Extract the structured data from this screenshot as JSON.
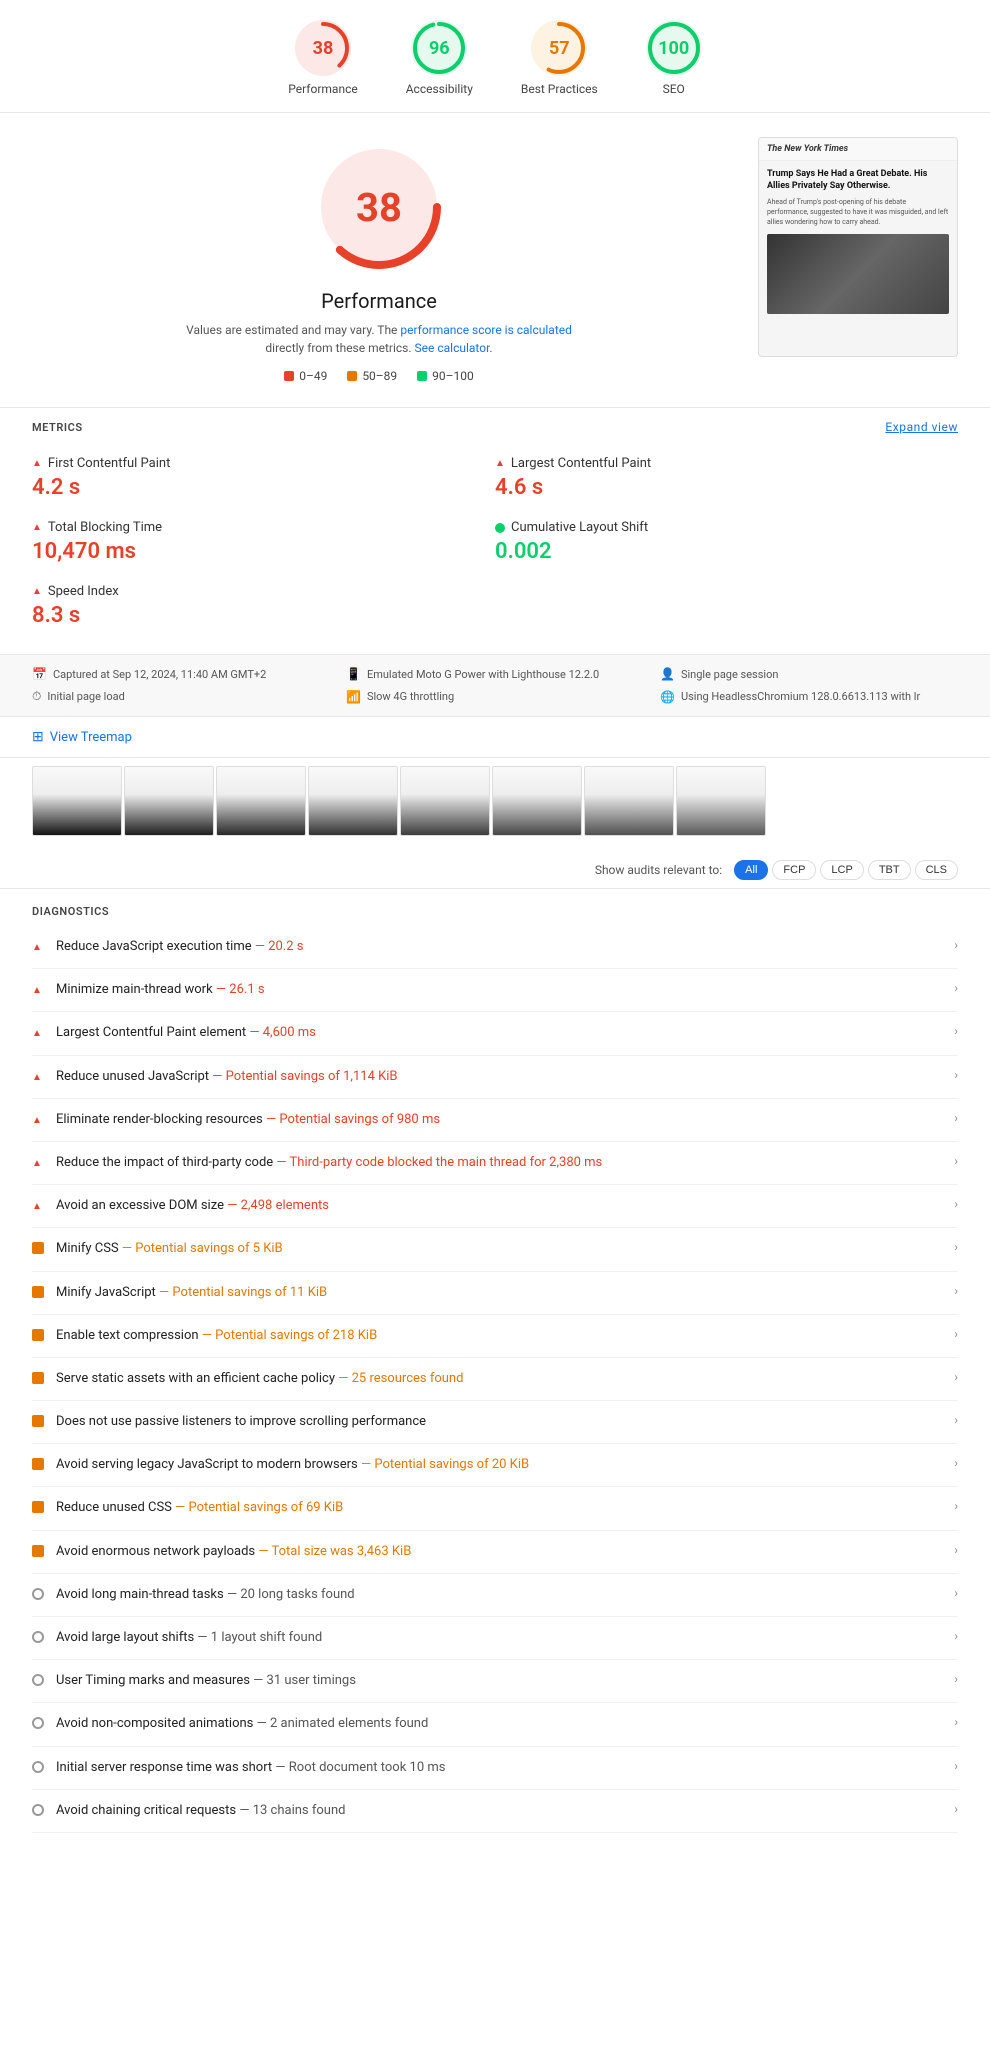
{
  "scores": [
    {
      "id": "performance",
      "label": "Performance",
      "value": 38,
      "color": "#e8412a",
      "bg": "#fce8e6",
      "dashoffset": 107
    },
    {
      "id": "accessibility",
      "label": "Accessibility",
      "value": 96,
      "color": "#0cce6b",
      "bg": "#e6f9ef",
      "dashoffset": 7
    },
    {
      "id": "best-practices",
      "label": "Best Practices",
      "value": 57,
      "color": "#e67700",
      "bg": "#fef3e2",
      "dashoffset": 75
    },
    {
      "id": "seo",
      "label": "SEO",
      "value": 100,
      "color": "#0cce6b",
      "bg": "#e6f9ef",
      "dashoffset": 0
    }
  ],
  "perf": {
    "score": 38,
    "title": "Performance",
    "desc1": "Values are estimated and may vary. The",
    "link1_text": "performance score is calculated",
    "desc2": "directly from these metrics.",
    "link2_text": "See calculator.",
    "legend": [
      {
        "label": "0–49",
        "color": "#e8412a"
      },
      {
        "label": "50–89",
        "color": "#e67700"
      },
      {
        "label": "90–100",
        "color": "#0cce6b"
      }
    ]
  },
  "screenshot": {
    "logo": "The New York Times",
    "headline": "Trump Says He Had a Great Debate. His Allies Privately Say Otherwise.",
    "text": "Ahead of Trump's post-opening of his debate performance, suggested to have it was misguided, and left allies wondering how to carry ahead."
  },
  "metrics_header": "METRICS",
  "expand_label": "Expand view",
  "metrics": [
    {
      "id": "fcp",
      "name": "First Contentful Paint",
      "value": "4.2 s",
      "color": "red",
      "icon": "tri"
    },
    {
      "id": "lcp",
      "name": "Largest Contentful Paint",
      "value": "4.6 s",
      "color": "red",
      "icon": "tri"
    },
    {
      "id": "tbt",
      "name": "Total Blocking Time",
      "value": "10,470 ms",
      "color": "red",
      "icon": "tri"
    },
    {
      "id": "cls",
      "name": "Cumulative Layout Shift",
      "value": "0.002",
      "color": "green",
      "icon": "dot"
    },
    {
      "id": "si",
      "name": "Speed Index",
      "value": "8.3 s",
      "color": "red",
      "icon": "tri"
    }
  ],
  "env": [
    {
      "icon": "📅",
      "text": "Captured at Sep 12, 2024, 11:40 AM GMT+2"
    },
    {
      "icon": "📱",
      "text": "Emulated Moto G Power with Lighthouse 12.2.0"
    },
    {
      "icon": "👤",
      "text": "Single page session"
    },
    {
      "icon": "⏱",
      "text": "Initial page load"
    },
    {
      "icon": "📶",
      "text": "Slow 4G throttling"
    },
    {
      "icon": "🌐",
      "text": "Using HeadlessChromium 128.0.6613.113 with lr"
    }
  ],
  "treemap_label": "View Treemap",
  "filter": {
    "label": "Show audits relevant to:",
    "buttons": [
      {
        "id": "all",
        "label": "All",
        "active": true
      },
      {
        "id": "fcp",
        "label": "FCP",
        "active": false
      },
      {
        "id": "lcp",
        "label": "LCP",
        "active": false
      },
      {
        "id": "tbt",
        "label": "TBT",
        "active": false
      },
      {
        "id": "cls",
        "label": "CLS",
        "active": false
      }
    ]
  },
  "diagnostics_header": "DIAGNOSTICS",
  "audits": [
    {
      "id": "js-exec",
      "icon": "tri",
      "title": "Reduce JavaScript execution time",
      "detail": " — 20.2 s",
      "detail_class": "red"
    },
    {
      "id": "main-thread",
      "icon": "tri",
      "title": "Minimize main-thread work",
      "detail": " — 26.1 s",
      "detail_class": "red"
    },
    {
      "id": "lcp-element",
      "icon": "tri",
      "title": "Largest Contentful Paint element",
      "detail": " — 4,600 ms",
      "detail_class": "red"
    },
    {
      "id": "unused-js",
      "icon": "tri",
      "title": "Reduce unused JavaScript",
      "detail": " — Potential savings of 1,114 KiB",
      "detail_class": "red"
    },
    {
      "id": "render-blocking",
      "icon": "tri",
      "title": "Eliminate render-blocking resources",
      "detail": " — Potential savings of 980 ms",
      "detail_class": "red"
    },
    {
      "id": "third-party",
      "icon": "tri",
      "title": "Reduce the impact of third-party code",
      "detail": " — Third-party code blocked the main thread for 2,380 ms",
      "detail_class": "red"
    },
    {
      "id": "dom-size",
      "icon": "tri",
      "title": "Avoid an excessive DOM size",
      "detail": " — 2,498 elements",
      "detail_class": "red"
    },
    {
      "id": "minify-css",
      "icon": "sq",
      "title": "Minify CSS",
      "detail": " — Potential savings of 5 KiB",
      "detail_class": "orange"
    },
    {
      "id": "minify-js",
      "icon": "sq",
      "title": "Minify JavaScript",
      "detail": " — Potential savings of 11 KiB",
      "detail_class": "orange"
    },
    {
      "id": "text-compression",
      "icon": "sq",
      "title": "Enable text compression",
      "detail": " — Potential savings of 218 KiB",
      "detail_class": "orange"
    },
    {
      "id": "cache-policy",
      "icon": "sq",
      "title": "Serve static assets with an efficient cache policy",
      "detail": " — 25 resources found",
      "detail_class": "orange"
    },
    {
      "id": "passive-listeners",
      "icon": "sq",
      "title": "Does not use passive listeners to improve scrolling performance",
      "detail": "",
      "detail_class": ""
    },
    {
      "id": "legacy-js",
      "icon": "sq",
      "title": "Avoid serving legacy JavaScript to modern browsers",
      "detail": " — Potential savings of 20 KiB",
      "detail_class": "orange"
    },
    {
      "id": "unused-css",
      "icon": "sq",
      "title": "Reduce unused CSS",
      "detail": " — Potential savings of 69 KiB",
      "detail_class": "orange"
    },
    {
      "id": "network-payloads",
      "icon": "sq",
      "title": "Avoid enormous network payloads",
      "detail": " — Total size was 3,463 KiB",
      "detail_class": "orange"
    },
    {
      "id": "long-tasks",
      "icon": "circle",
      "title": "Avoid long main-thread tasks",
      "detail": " — 20 long tasks found",
      "detail_class": ""
    },
    {
      "id": "layout-shifts",
      "icon": "circle",
      "title": "Avoid large layout shifts",
      "detail": " — 1 layout shift found",
      "detail_class": ""
    },
    {
      "id": "user-timing",
      "icon": "circle",
      "title": "User Timing marks and measures",
      "detail": " — 31 user timings",
      "detail_class": ""
    },
    {
      "id": "non-composited",
      "icon": "circle",
      "title": "Avoid non-composited animations",
      "detail": " — 2 animated elements found",
      "detail_class": ""
    },
    {
      "id": "server-response",
      "icon": "circle",
      "title": "Initial server response time was short",
      "detail": " — Root document took 10 ms",
      "detail_class": ""
    },
    {
      "id": "critical-requests",
      "icon": "circle",
      "title": "Avoid chaining critical requests",
      "detail": " — 13 chains found",
      "detail_class": ""
    }
  ]
}
